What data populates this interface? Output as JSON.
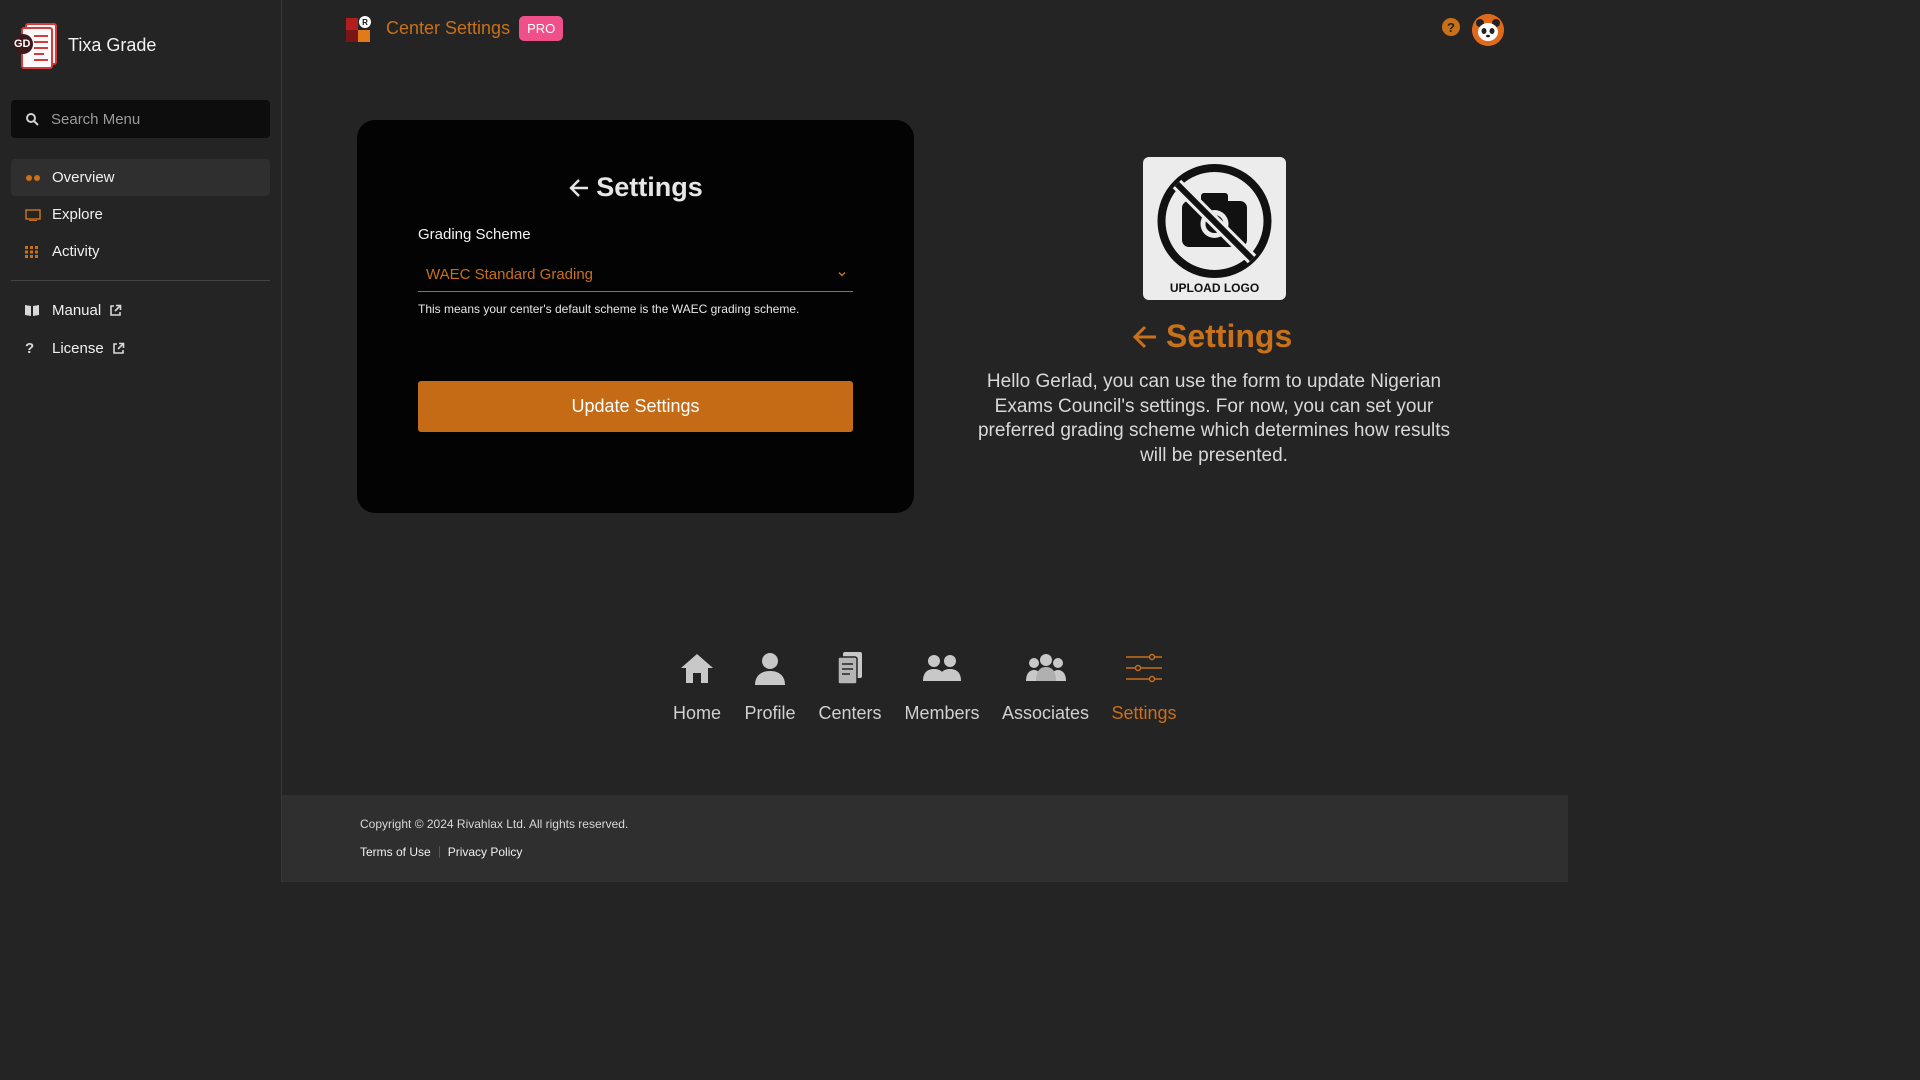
{
  "brand": {
    "name": "Tixa Grade",
    "logo_initials": "GD"
  },
  "search": {
    "placeholder": "Search Menu"
  },
  "sidebar": {
    "items": [
      {
        "label": "Overview",
        "icon": "dots-icon",
        "active": true
      },
      {
        "label": "Explore",
        "icon": "monitor-icon"
      },
      {
        "label": "Activity",
        "icon": "grid-icon"
      }
    ],
    "links": [
      {
        "label": "Manual",
        "icon": "book-icon"
      },
      {
        "label": "License",
        "icon": "question-icon"
      }
    ]
  },
  "header": {
    "title": "Center Settings",
    "badge": "PRO",
    "help": "?"
  },
  "form": {
    "title": "Settings",
    "field_label": "Grading Scheme",
    "selected_value": "WAEC Standard Grading",
    "helper_text": "This means your center's default scheme is the WAEC grading scheme.",
    "submit_label": "Update Settings"
  },
  "info": {
    "upload_label": "UPLOAD LOGO",
    "title": "Settings",
    "description": "Hello Gerlad, you can use the form to update Nigerian Exams Council's settings. For now, you can set your preferred grading scheme which determines how results will be presented."
  },
  "bottom_nav": [
    {
      "label": "Home",
      "icon": "home-icon"
    },
    {
      "label": "Profile",
      "icon": "person-icon"
    },
    {
      "label": "Centers",
      "icon": "document-icon"
    },
    {
      "label": "Members",
      "icon": "people-icon"
    },
    {
      "label": "Associates",
      "icon": "group-icon"
    },
    {
      "label": "Settings",
      "icon": "sliders-icon",
      "active": true
    }
  ],
  "footer": {
    "copyright": "Copyright © 2024 Rivahlax Ltd. All rights reserved.",
    "terms": "Terms of Use",
    "privacy": "Privacy Policy"
  },
  "colors": {
    "accent": "#c8701a",
    "button": "#c56a15",
    "badge": "#f0508a",
    "card": "#030303",
    "background": "#242424"
  }
}
